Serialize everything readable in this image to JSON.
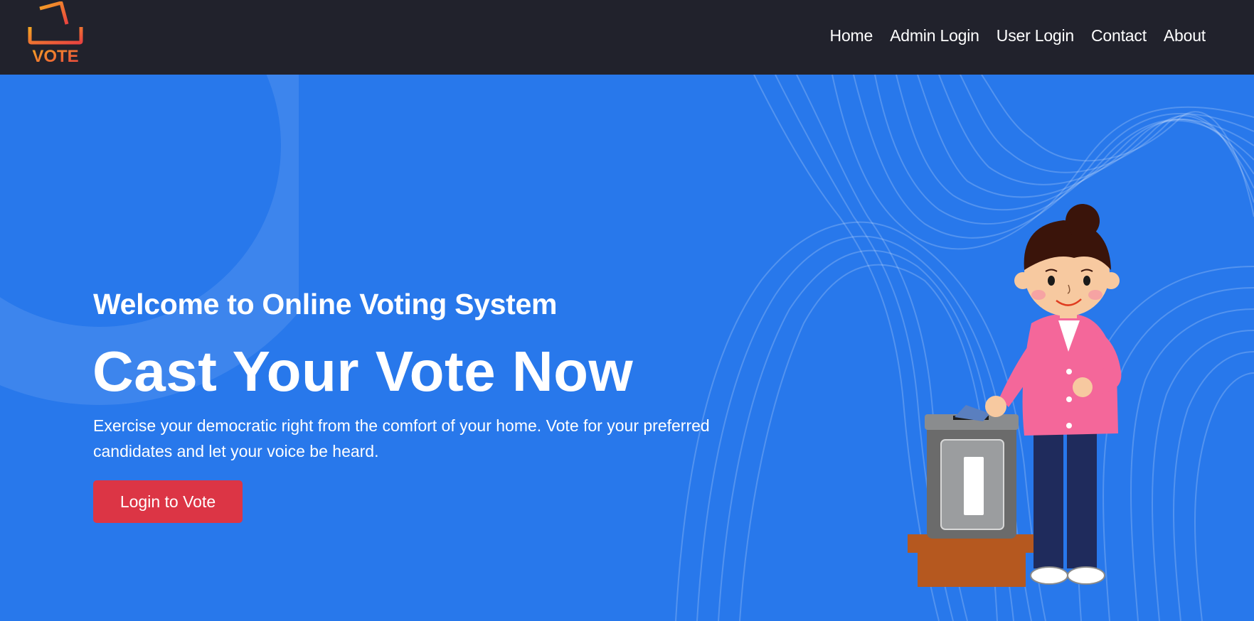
{
  "nav": {
    "logo_text": "VOTE",
    "links": [
      "Home",
      "Admin Login",
      "User Login",
      "Contact",
      "About"
    ]
  },
  "hero": {
    "subtitle": "Welcome to Online Voting System",
    "title": "Cast Your Vote Now",
    "description": "Exercise your democratic right from the comfort of your home. Vote for your preferred candidates and let your voice be heard.",
    "cta_label": "Login to Vote"
  },
  "colors": {
    "navbar_bg": "#21222c",
    "hero_bg": "#2878eb",
    "button_bg": "#dc3545",
    "logo_gradient_start": "#f5a623",
    "logo_gradient_end": "#e8423f"
  },
  "icons": {
    "logo": "ballot-box-vote-logo",
    "illustration": "woman-voting-ballot-box"
  }
}
